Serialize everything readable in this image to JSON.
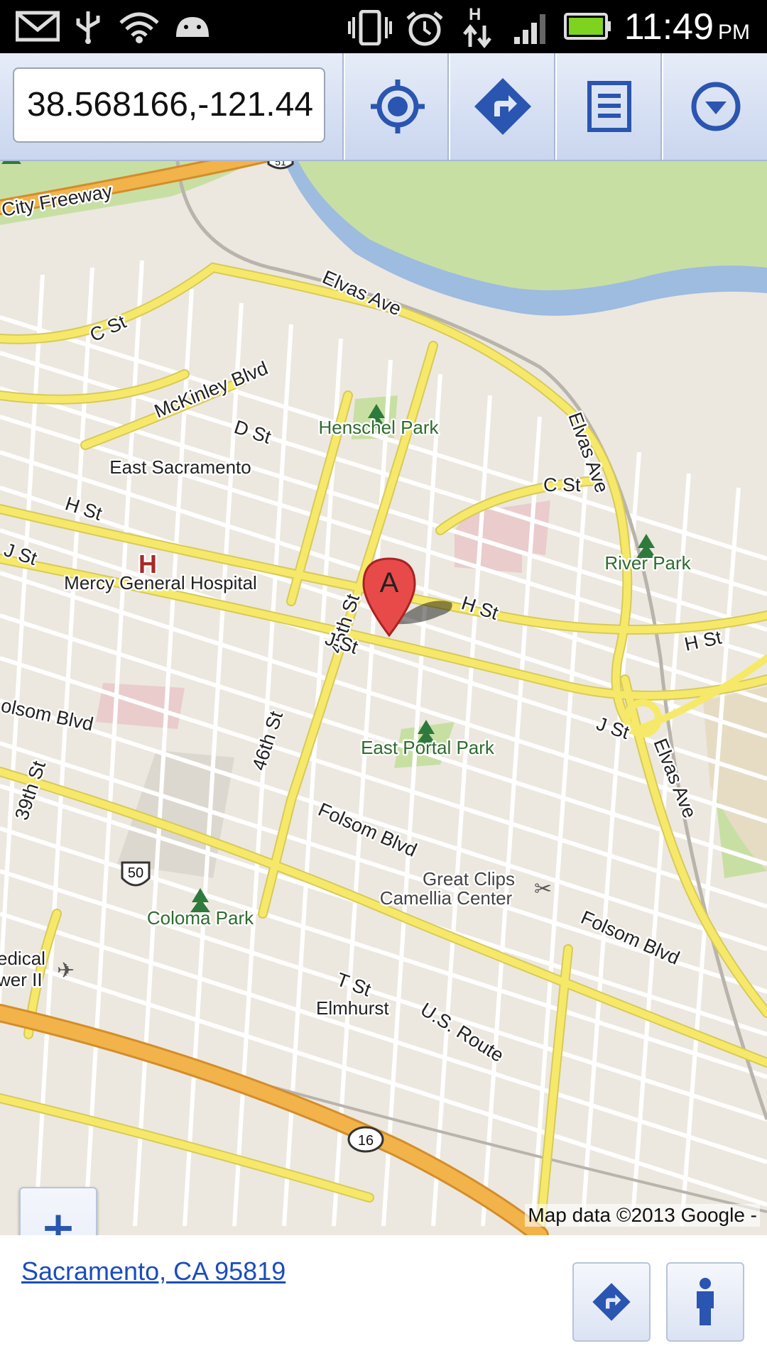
{
  "status_bar": {
    "time": "11:49",
    "ampm": "PM",
    "icons": [
      "gmail-icon",
      "usb-icon",
      "wifi-icon",
      "android-icon",
      "vibrate-icon",
      "alarm-icon",
      "hspa-data-icon",
      "signal-icon",
      "battery-icon"
    ]
  },
  "toolbar": {
    "coordinates_value": "38.568166,-121.44",
    "buttons": [
      "my-location",
      "directions",
      "list",
      "menu-dropdown"
    ]
  },
  "map": {
    "labels": {
      "city_freeway": "City Freeway",
      "elvas_ave_top": "Elvas Ave",
      "c_st_left": "C St",
      "mckinley_blvd": "McKinley Blvd",
      "henschel_park": "Henschel Park",
      "d_st": "D St",
      "east_sacramento": "East Sacramento",
      "elvas_ave_right": "Elvas Ave",
      "c_st_right": "C St",
      "h_st_left": "H St",
      "st_45th": "45th St",
      "j_st_left": "J St",
      "mercy_general_hospital": "Mercy General Hospital",
      "hospital_symbol": "H",
      "river_park": "River Park",
      "h_st_center": "H St",
      "h_st_right": "H St",
      "j_st_center": "J St",
      "j_st_right": "J St",
      "folsom_blvd_left": "olsom Blvd",
      "st_46th": "46th St",
      "east_portal_park": "East Portal Park",
      "elvas_ave_bottom": "Elvas Ave",
      "st_39th": "39th St",
      "folsom_blvd_center": "Folsom Blvd",
      "great_clips": "Great Clips",
      "camellia_center": "Camellia Center",
      "folsom_blvd_right": "Folsom Blvd",
      "route_50_shield": "50",
      "coloma_park": "Coloma Park",
      "route_16_shield": "16",
      "us_route": "U.S. Route",
      "t_st": "T St",
      "elmhurst": "Elmhurst",
      "edical": "edical",
      "wer_ii": "wer II",
      "route_51_shield": "51"
    },
    "marker_letter": "A",
    "zoom_in": "+",
    "zoom_out": "−",
    "attribution": "Map data ©2013 Google -"
  },
  "bottom_bar": {
    "address": "Sacramento, CA 95819",
    "buttons": [
      "directions",
      "street-view"
    ]
  },
  "colors": {
    "toolbar": "#cad6ef",
    "map_background": "#ece8df",
    "road_major": "#f6e96a",
    "freeway": "#f2b34a",
    "park": "#c8dfa4",
    "water": "#9ebbe0",
    "link": "#1b4dba"
  }
}
